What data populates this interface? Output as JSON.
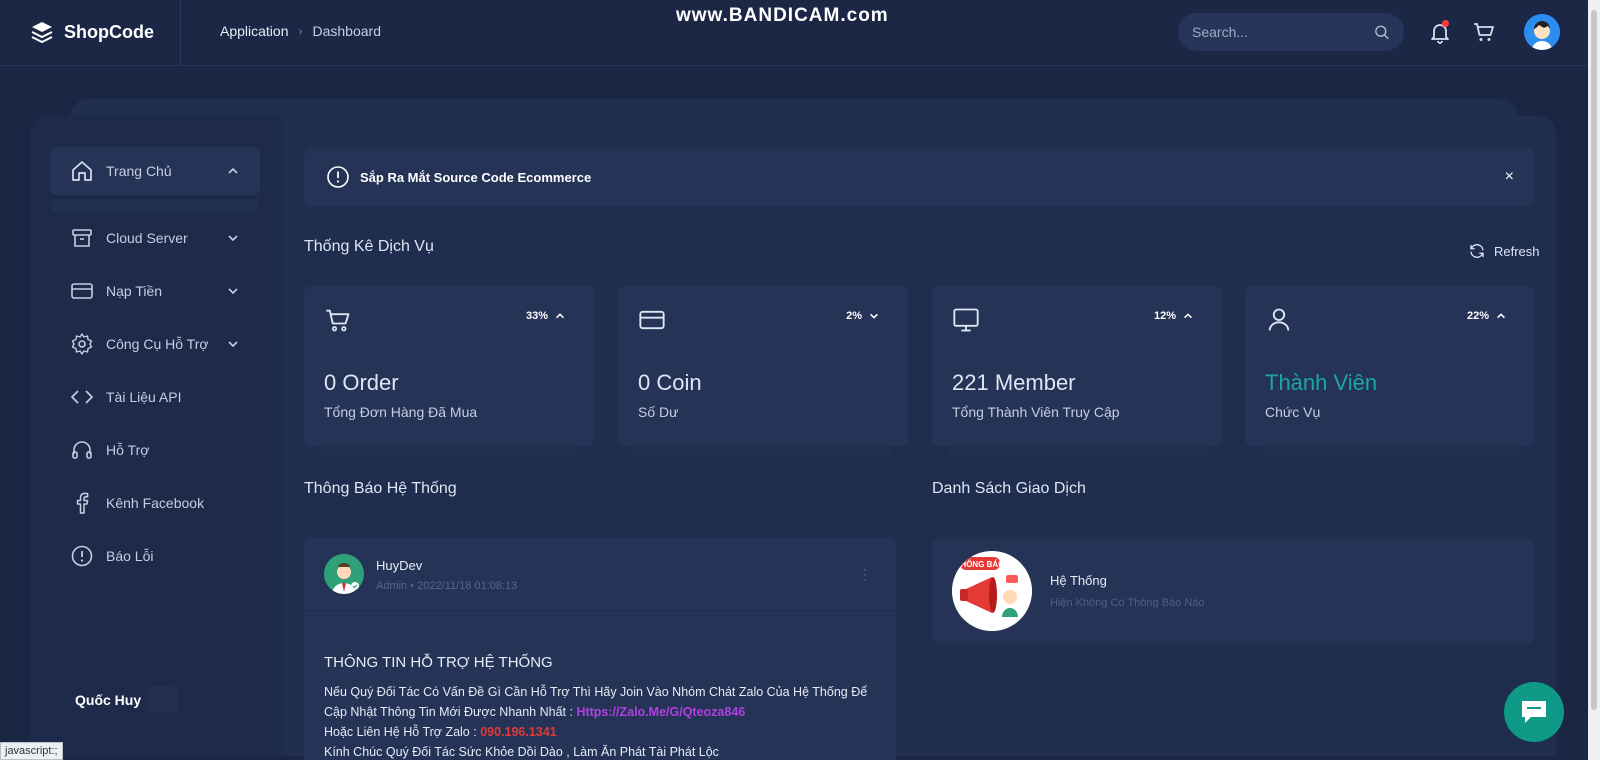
{
  "header": {
    "logo_text": "ShopCode",
    "breadcrumb": [
      "Application",
      "Dashboard"
    ],
    "watermark": "www.BANDICAM.com",
    "search_placeholder": "Search..."
  },
  "sidebar": {
    "items": [
      {
        "label": "Trang Chủ",
        "icon": "home-icon",
        "chevron": "up"
      },
      {
        "label": "Cloud Server",
        "icon": "archive-icon",
        "chevron": "down"
      },
      {
        "label": "Nạp Tiền",
        "icon": "credit-card-icon",
        "chevron": "down"
      },
      {
        "label": "Công Cụ Hỗ Trợ",
        "icon": "gear-icon",
        "chevron": "down"
      },
      {
        "label": "Tài Liệu API",
        "icon": "code-icon"
      },
      {
        "label": "Hỗ Trợ",
        "icon": "headphones-icon"
      },
      {
        "label": "Kênh Facebook",
        "icon": "facebook-icon"
      },
      {
        "label": "Báo Lỗi",
        "icon": "alert-circle-icon"
      }
    ],
    "user_name": "Quốc Huy"
  },
  "alert": {
    "text": "Sắp Ra Mắt Source Code Ecommerce",
    "close": "×"
  },
  "stats": {
    "title": "Thống Kê Dịch Vụ",
    "refresh_label": "Refresh",
    "cards": [
      {
        "icon": "cart-icon",
        "percent": "33%",
        "trend": "up",
        "value": "0 Order",
        "label": "Tổng Đơn Hàng Đã Mua"
      },
      {
        "icon": "credit-card-icon",
        "percent": "2%",
        "trend": "down",
        "value": "0 Coin",
        "label": "Số Dư"
      },
      {
        "icon": "monitor-icon",
        "percent": "12%",
        "trend": "up",
        "value": "221 Member",
        "label": "Tổng Thành Viên Truy Cập"
      },
      {
        "icon": "user-icon",
        "percent": "22%",
        "trend": "up",
        "value": "Thành Viên",
        "label": "Chức Vụ",
        "value_color": "#1ca7a0"
      }
    ]
  },
  "notices": {
    "title": "Thông Báo Hệ Thống",
    "post": {
      "author": "HuyDev",
      "role": "Admin",
      "timestamp": "2022/11/18 01:08:13",
      "heading": "THÔNG TIN HỖ TRỢ HỆ THỐNG",
      "line1": "Nếu Quý Đối Tác Có Vấn Đề Gì Cần Hỗ Trợ Thì Hãy Join Vào Nhóm Chát Zalo Của Hệ Thống Để Cập Nhật Thông Tin Mới Được Nhanh Nhất : ",
      "link": "Https://Zalo.Me/G/Qteoza846",
      "line2_prefix": "Hoặc Liên Hệ Hỗ Trợ Zalo : ",
      "phone": "090.196.1341",
      "line3": "Kính Chúc Quý Đối Tác Sức Khỏe Dồi Dào , Làm Ăn Phát Tài Phát Lộc"
    }
  },
  "transactions": {
    "title": "Danh Sách Giao Dịch",
    "item": {
      "logo_text": "THÔNG BÁO",
      "name": "Hệ Thống",
      "subtitle": "Hiện Không Có Thông Báo Nào"
    }
  },
  "statusbar": {
    "text": "javascript:;"
  },
  "colors": {
    "background": "#1a2644",
    "card": "#243356",
    "accent_teal": "#1ca7a0",
    "link_purple": "#b040e0",
    "phone_red": "#e53935",
    "chat": "#0e9a86"
  }
}
